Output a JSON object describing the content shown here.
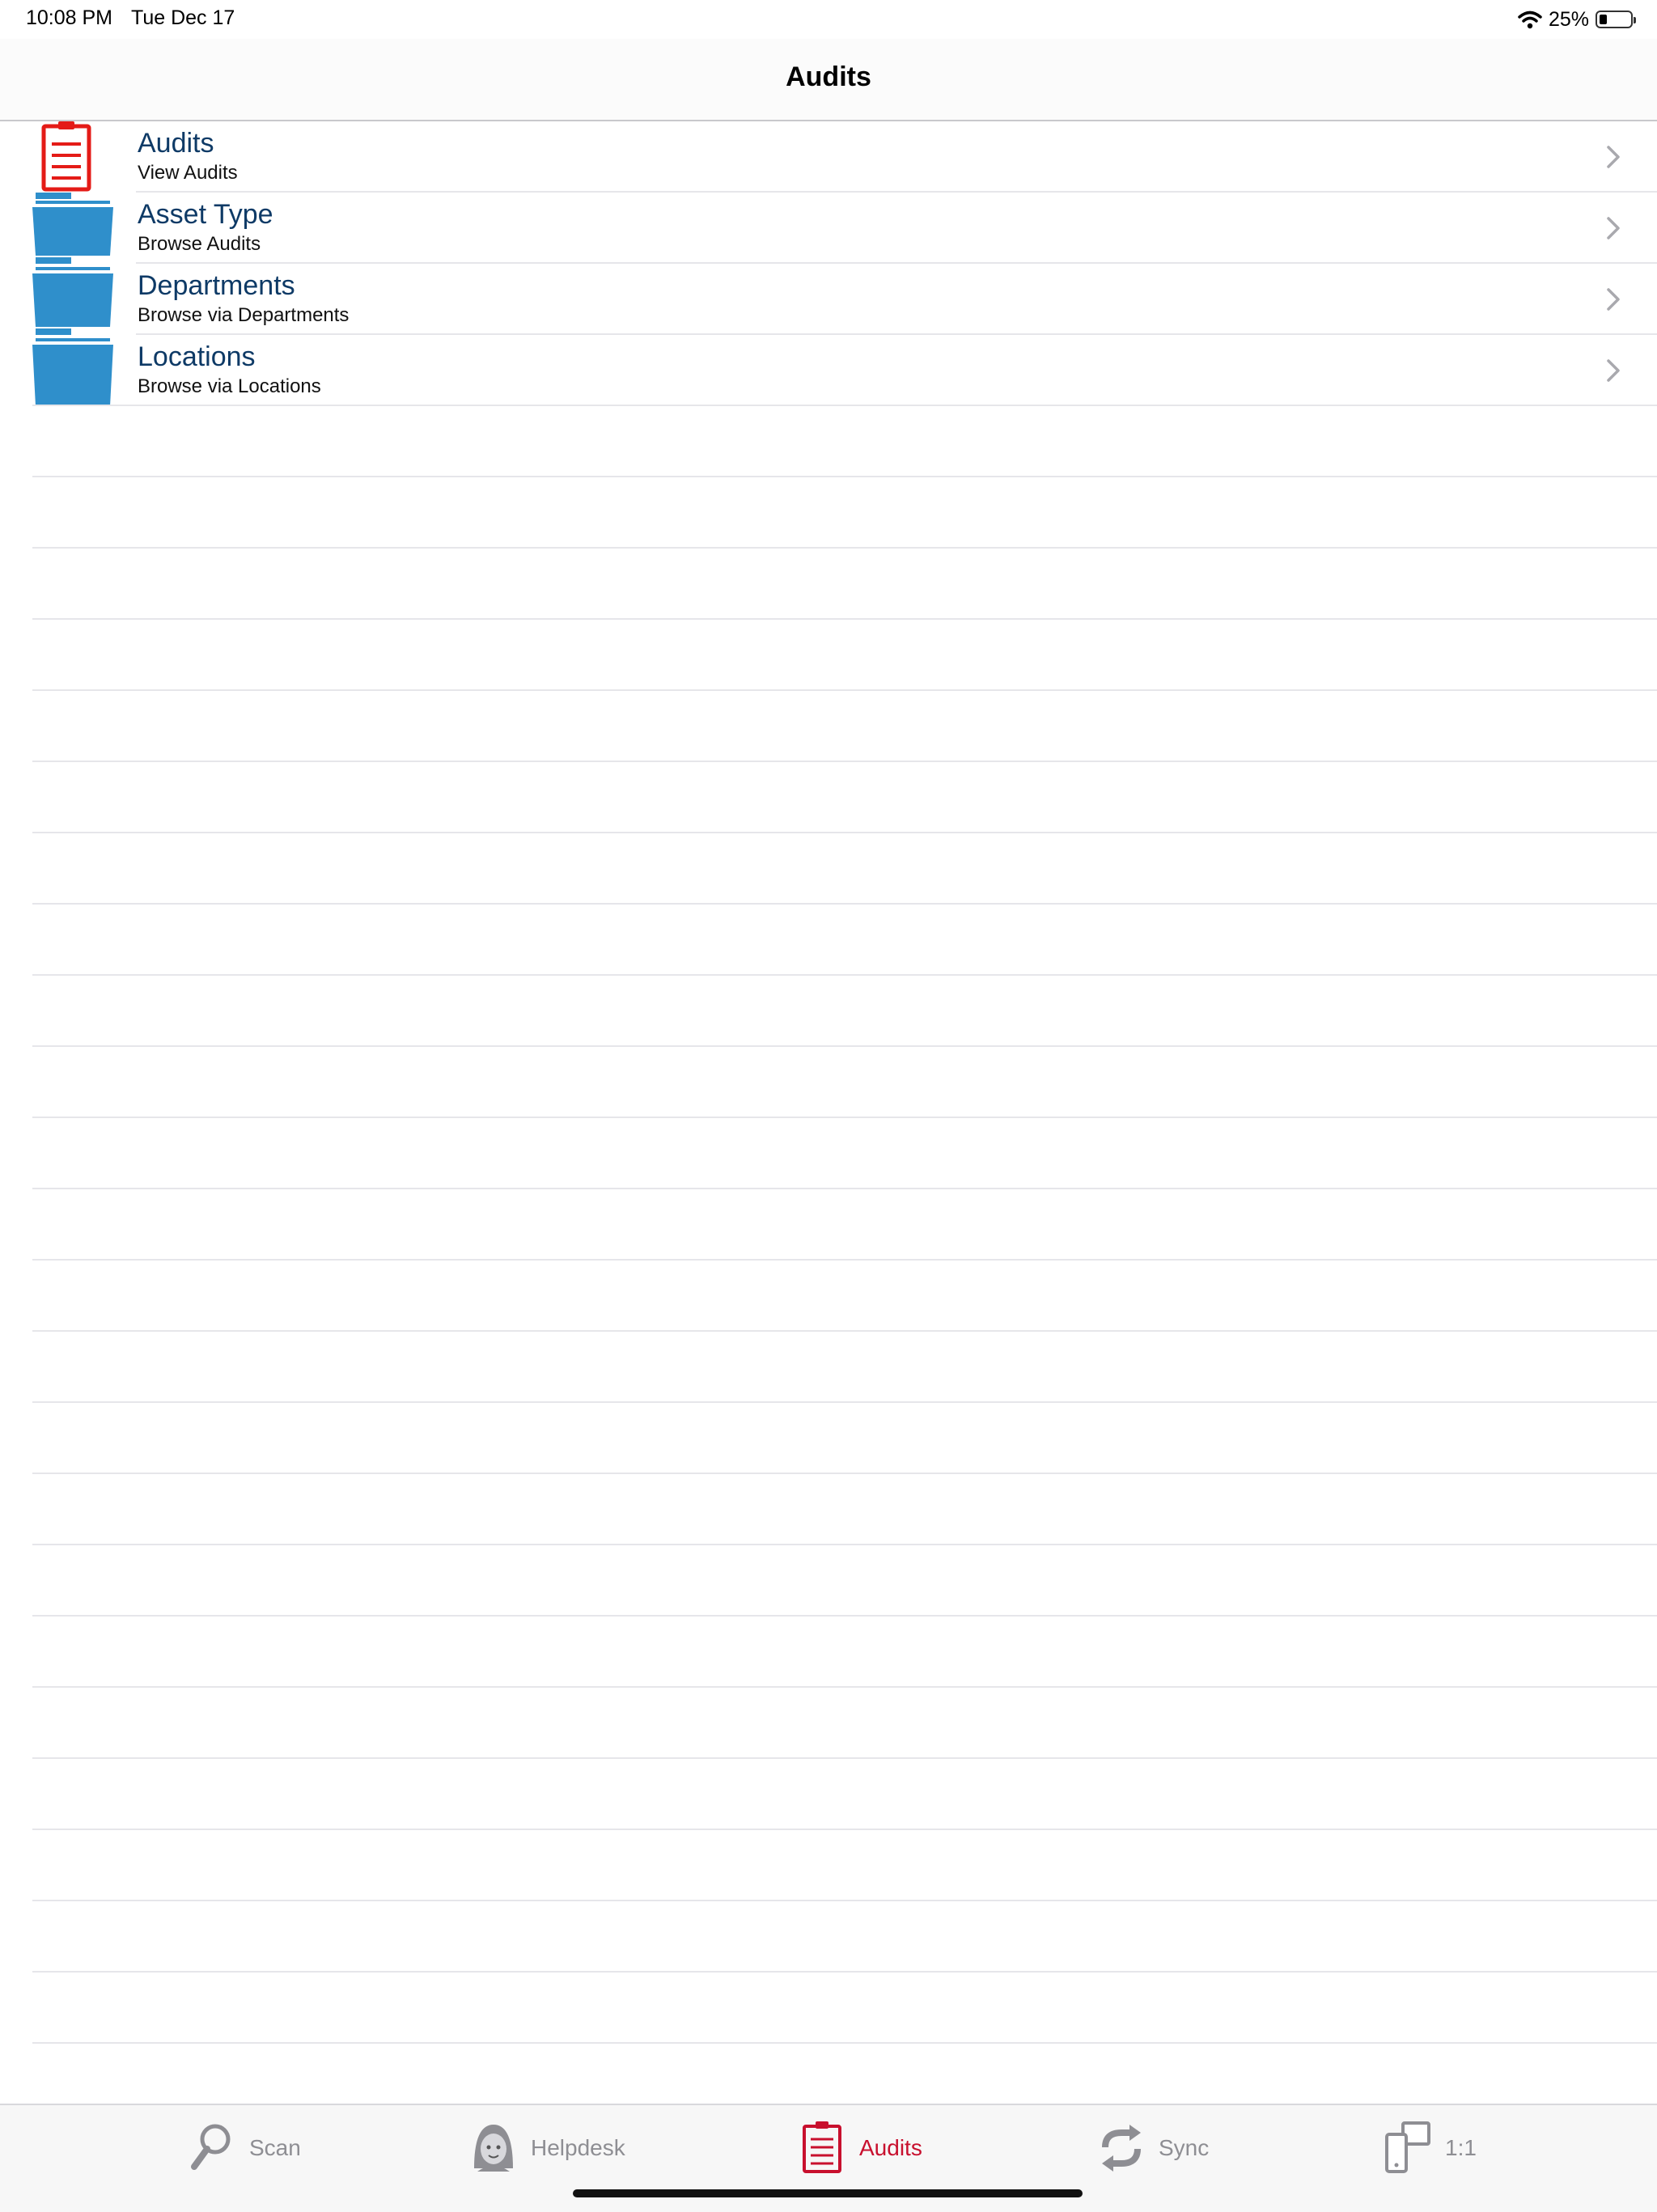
{
  "status_bar": {
    "time": "10:08 PM",
    "date": "Tue Dec 17",
    "battery_text": "25%",
    "battery_level": 0.25
  },
  "nav": {
    "title": "Audits"
  },
  "list": {
    "items": [
      {
        "title": "Audits",
        "subtitle": "View Audits",
        "icon": "clipboard-icon"
      },
      {
        "title": "Asset Type",
        "subtitle": "Browse Audits",
        "icon": "folder-icon"
      },
      {
        "title": "Departments",
        "subtitle": "Browse via Departments",
        "icon": "folder-icon"
      },
      {
        "title": "Locations",
        "subtitle": "Browse via Locations",
        "icon": "folder-icon"
      }
    ]
  },
  "tab_bar": {
    "tabs": [
      {
        "label": "Scan",
        "icon": "magnifier-icon",
        "active": false
      },
      {
        "label": "Helpdesk",
        "icon": "support-agent-icon",
        "active": false
      },
      {
        "label": "Audits",
        "icon": "clipboard-icon",
        "active": true
      },
      {
        "label": "Sync",
        "icon": "sync-icon",
        "active": false
      },
      {
        "label": "1:1",
        "icon": "devices-icon",
        "active": false
      }
    ]
  },
  "colors": {
    "accent_red": "#c8102e",
    "folder_blue": "#2f8fcb",
    "title_blue": "#0e3a66",
    "inactive_gray": "#8e8e93"
  }
}
